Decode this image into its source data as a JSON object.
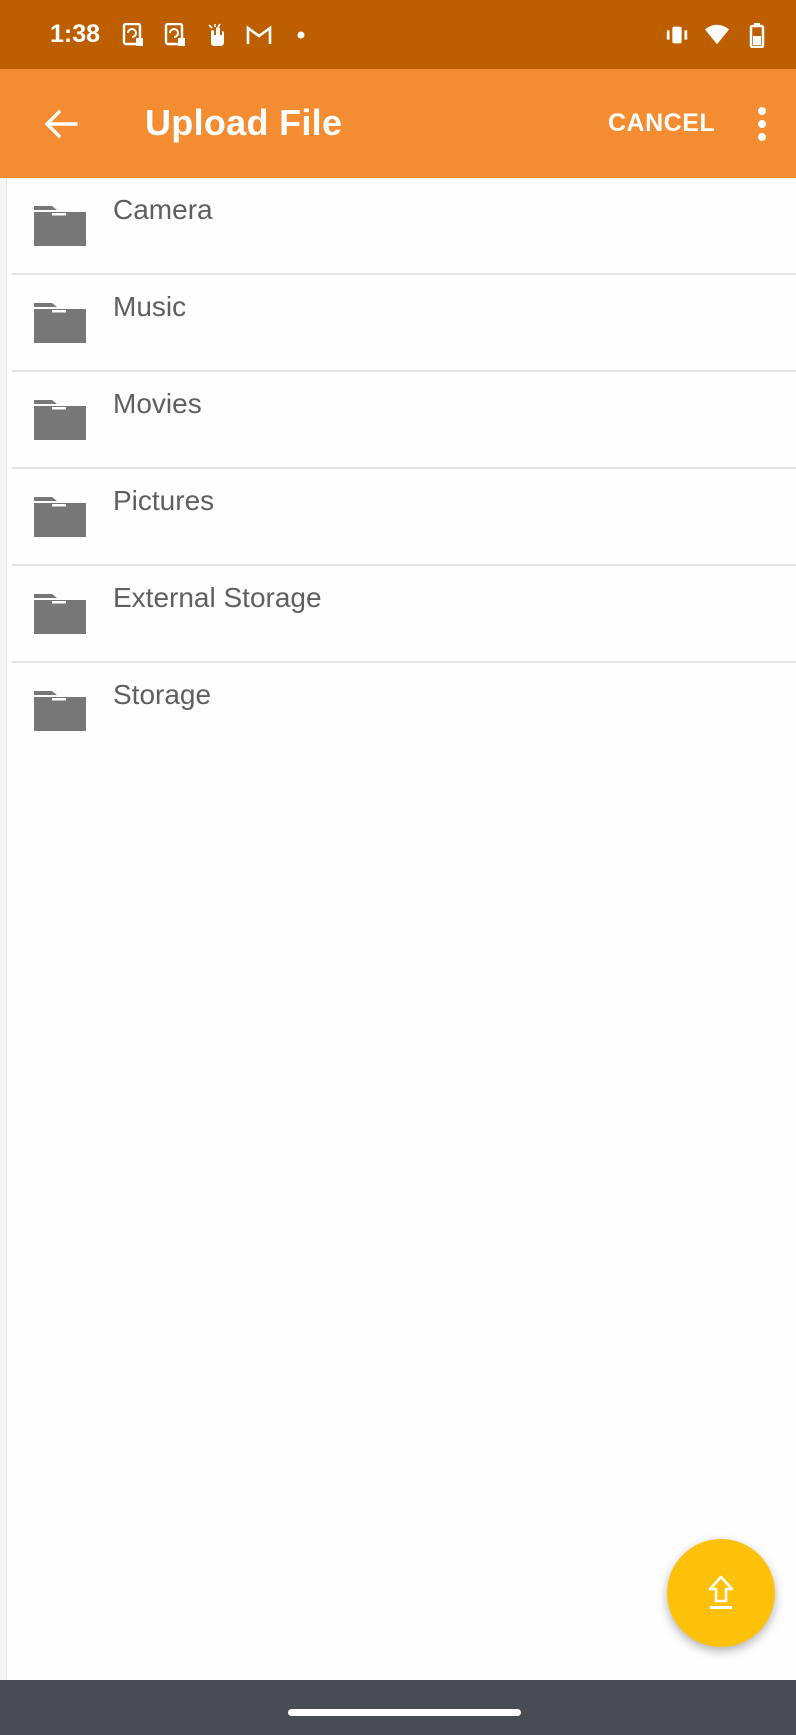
{
  "status_bar": {
    "time": "1:38",
    "left_icons": [
      "phone-sync-icon",
      "phone-sync-icon",
      "hand-gesture-icon",
      "gmail-icon",
      "dot-icon"
    ],
    "right_icons": [
      "vibrate-icon",
      "wifi-icon",
      "battery-icon"
    ]
  },
  "app_bar": {
    "title": "Upload File",
    "cancel_label": "CANCEL",
    "background": "#f48c31"
  },
  "folders": [
    {
      "label": "Camera"
    },
    {
      "label": "Music"
    },
    {
      "label": "Movies"
    },
    {
      "label": "Pictures"
    },
    {
      "label": "External Storage"
    },
    {
      "label": "Storage"
    }
  ],
  "fab": {
    "icon": "upload-icon",
    "color": "#fec10a"
  },
  "colors": {
    "status_bar": "#bd5e00",
    "folder_icon": "#777777",
    "nav_bar": "#474d53"
  }
}
